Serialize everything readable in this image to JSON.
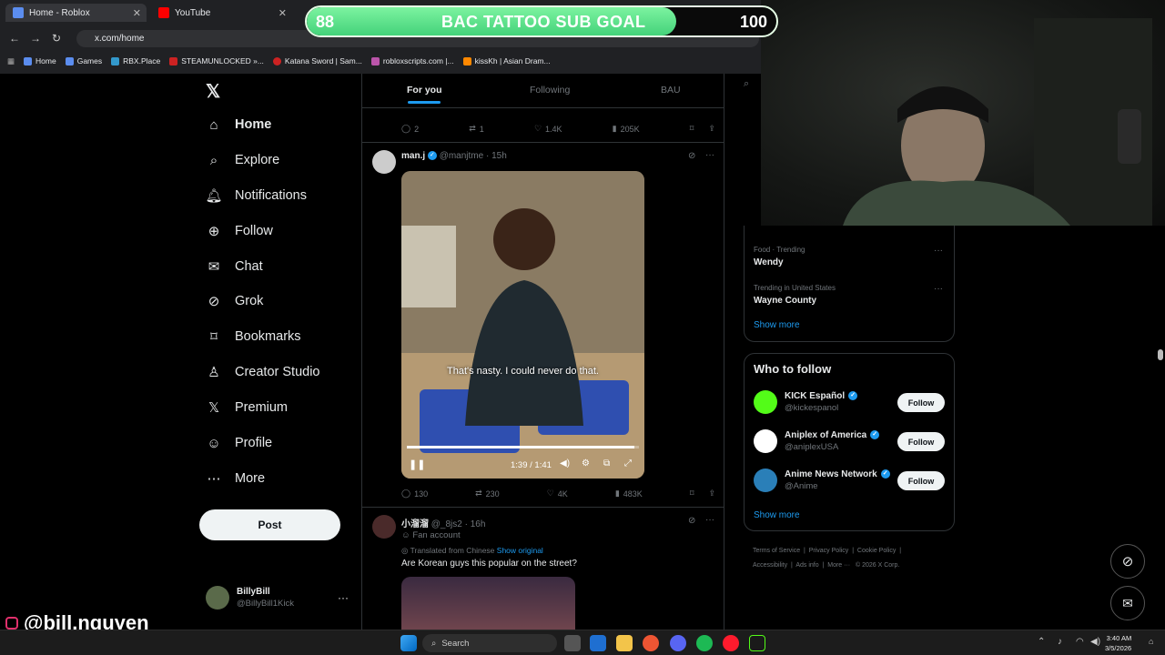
{
  "browser": {
    "tabs": [
      {
        "label": "Home - Roblox"
      },
      {
        "label": "YouTube"
      }
    ],
    "address": "x.com/home",
    "bookmarks": [
      "Home",
      "Games",
      "RBX.Place",
      "STEAMUNLOCKED »...",
      "Katana Sword | Sam...",
      "robloxscripts.com |...",
      "kissKh | Asian Dram..."
    ]
  },
  "sub_goal": {
    "current": "88",
    "title": "BAC TATTOO SUB GOAL",
    "target": "100",
    "progress": 0.88
  },
  "nav": {
    "items": [
      {
        "label": "Home",
        "icon": "home-icon"
      },
      {
        "label": "Explore",
        "icon": "search-icon"
      },
      {
        "label": "Notifications",
        "icon": "bell-icon"
      },
      {
        "label": "Follow",
        "icon": "add-person-icon"
      },
      {
        "label": "Chat",
        "icon": "mail-icon"
      },
      {
        "label": "Grok",
        "icon": "grok-icon"
      },
      {
        "label": "Bookmarks",
        "icon": "bookmark-icon"
      },
      {
        "label": "Creator Studio",
        "icon": "creator-icon"
      },
      {
        "label": "Premium",
        "icon": "x-icon"
      },
      {
        "label": "Profile",
        "icon": "person-icon"
      },
      {
        "label": "More",
        "icon": "more-icon"
      }
    ],
    "post_label": "Post",
    "account": {
      "name": "BillyBill",
      "handle": "@BillyBill1Kick"
    }
  },
  "feed": {
    "tabs": [
      "For you",
      "Following",
      "BAU"
    ],
    "prev_actions": {
      "replies": "2",
      "reposts": "1",
      "likes": "1.4K",
      "views": "205K"
    },
    "post1": {
      "name": "man.j",
      "handle": "@manjtme",
      "time": "· 15h",
      "subtitle": "That's nasty. I could never do that.",
      "video_time": "1:39 / 1:41",
      "progress": 0.98,
      "actions": {
        "replies": "130",
        "reposts": "230",
        "likes": "4K",
        "views": "483K"
      }
    },
    "post2": {
      "name": "小溜溜",
      "handle": "@_8js2",
      "time": "· 16h",
      "badge": "Fan account",
      "translated": "Translated from Chinese",
      "show_original": "Show original",
      "text": "Are Korean guys this popular on the street?"
    }
  },
  "trends": [
    {
      "meta": "Food · Trending",
      "name": "Wendy"
    },
    {
      "meta": "Trending in United States",
      "name": "Wayne County"
    }
  ],
  "show_more": "Show more",
  "who_to_follow": {
    "title": "Who to follow",
    "follow_label": "Follow",
    "accounts": [
      {
        "name": "KICK Español",
        "handle": "@kickespanol",
        "color": "#53fc18"
      },
      {
        "name": "Aniplex of America",
        "handle": "@aniplexUSA",
        "color": "#ffffff"
      },
      {
        "name": "Anime News Network",
        "handle": "@Anime",
        "color": "#2a7fb8"
      }
    ]
  },
  "footer": {
    "links": [
      "Terms of Service",
      "Privacy Policy",
      "Cookie Policy",
      "Accessibility",
      "Ads info",
      "More ···",
      "© 2026 X Corp."
    ]
  },
  "overlay": {
    "instagram": "@bill.nguyen"
  },
  "taskbar": {
    "search": "Search",
    "time": "3:40 AM",
    "date": "3/5/2026"
  }
}
